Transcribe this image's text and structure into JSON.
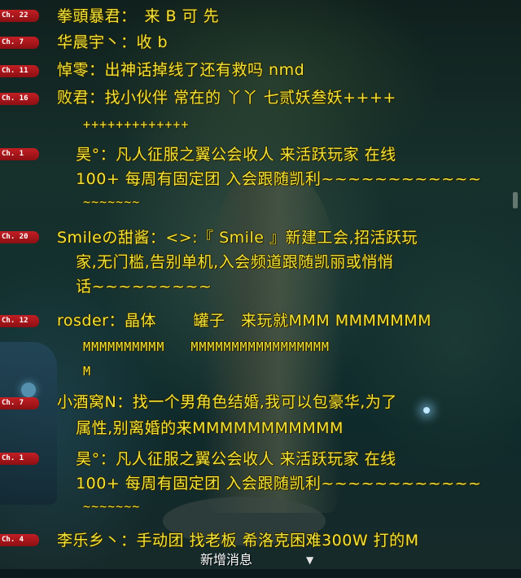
{
  "messages": [
    {
      "channel": "Ch. 22",
      "lines": [
        "拳頭暴君：　来 B 可 先"
      ]
    },
    {
      "channel": "Ch. 7",
      "lines": [
        "华晨宇丶：收 b"
      ]
    },
    {
      "channel": "Ch. 11",
      "lines": [
        "悼零：出神话掉线了还有救吗 nmd"
      ]
    },
    {
      "channel": "Ch. 16",
      "lines": [
        "败君：找小伙伴 常在的 丫丫 七贰妖叁妖++++",
        "  +++++++++++++"
      ]
    },
    {
      "channel": "Ch. 1",
      "lines": [
        "  昊°：凡人征服之翼公会收人 来活跃玩家 在线",
        "  100+ 每周有固定团 入会跟随凯利~~~~~~~~~~~~",
        "  ~~~~~~~"
      ]
    },
    {
      "channel": "Ch. 20",
      "lines": [
        "Smileの甜酱：<>:『 Smile 』新建工会,招活跃玩",
        "  家,无门槛,告别单机,入会频道跟随凯丽或悄悄",
        "  话~~~~~~~~~"
      ]
    },
    {
      "channel": "Ch. 12",
      "lines": [
        "rosder：晶体　　 罐子　来玩就MMM MMMMMMM",
        "  MMMMMMMMMM　　MMMMMMMMMMMMMMMMM",
        "  M"
      ]
    },
    {
      "channel": "Ch. 7",
      "lines": [
        "小酒窝N：找一个男角色结婚,我可以包豪华,为了",
        "  属性,别离婚的来MMMMMMMMMMM"
      ]
    },
    {
      "channel": "Ch. 1",
      "lines": [
        "  昊°：凡人征服之翼公会收人 来活跃玩家 在线",
        "  100+ 每周有固定团 入会跟随凯利~~~~~~~~~~~~",
        "  ~~~~~~~"
      ]
    },
    {
      "channel": "Ch. 4",
      "lines": [
        "李乐乡丶：手动团 找老板 希洛克困难300W 打的M"
      ]
    }
  ],
  "new_messages_label": "新增消息",
  "new_messages_icon": "arrow-down-icon"
}
